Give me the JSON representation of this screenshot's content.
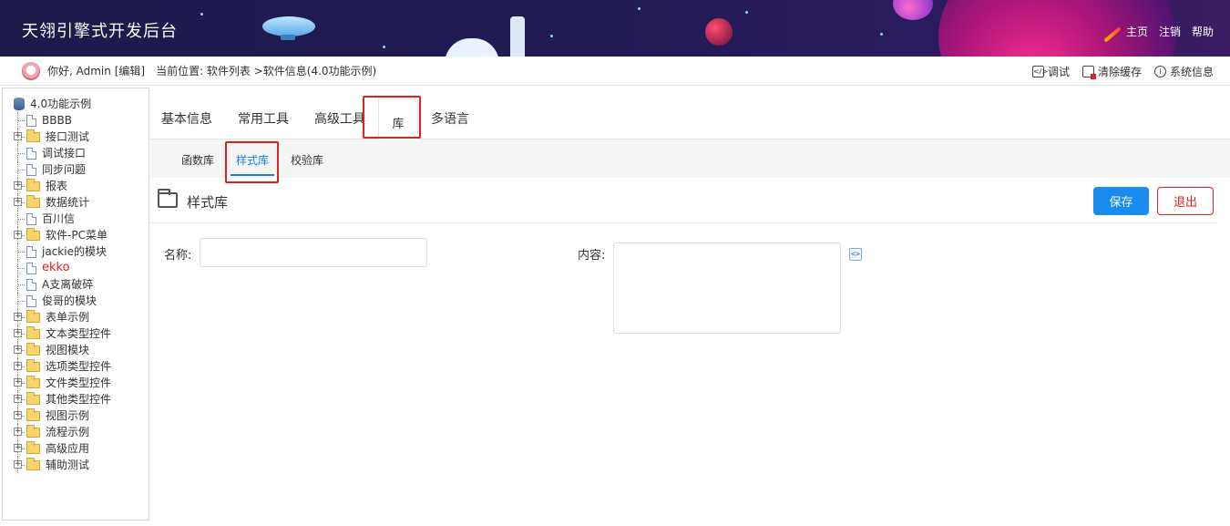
{
  "header": {
    "title": "天翎引擎式开发后台",
    "links": [
      "主页",
      "注销",
      "帮助"
    ]
  },
  "infobar": {
    "greeting": "你好, Admin [编辑]",
    "breadcrumb": "当前位置: 软件列表 >软件信息(4.0功能示例)",
    "debug": "调试",
    "clear_cache": "清除缓存",
    "system_info": "系统信息"
  },
  "tree": {
    "root": "4.0功能示例",
    "items": [
      {
        "label": "BBBB",
        "type": "file"
      },
      {
        "label": "接口测试",
        "type": "folder"
      },
      {
        "label": "调试接口",
        "type": "file"
      },
      {
        "label": "同步问题",
        "type": "file"
      },
      {
        "label": "报表",
        "type": "folder"
      },
      {
        "label": "数据统计",
        "type": "folder"
      },
      {
        "label": "百川信",
        "type": "file"
      },
      {
        "label": "软件-PC菜单",
        "type": "folder"
      },
      {
        "label": "jackie的模块",
        "type": "file"
      },
      {
        "label": "ekko",
        "type": "file",
        "highlight": true
      },
      {
        "label": "A支离破碎",
        "type": "file"
      },
      {
        "label": "俊哥的模块",
        "type": "file"
      },
      {
        "label": "表单示例",
        "type": "folder"
      },
      {
        "label": "文本类型控件",
        "type": "folder"
      },
      {
        "label": "视图模块",
        "type": "folder"
      },
      {
        "label": "选项类型控件",
        "type": "folder"
      },
      {
        "label": "文件类型控件",
        "type": "folder"
      },
      {
        "label": "其他类型控件",
        "type": "folder"
      },
      {
        "label": "视图示例",
        "type": "folder"
      },
      {
        "label": "流程示例",
        "type": "folder"
      },
      {
        "label": "高级应用",
        "type": "folder"
      },
      {
        "label": "辅助测试",
        "type": "folder"
      }
    ]
  },
  "tabs": {
    "basic": "基本信息",
    "tools": "常用工具",
    "advanced": "高级工具",
    "library": "库",
    "i18n": "多语言"
  },
  "subtabs": {
    "functions": "函数库",
    "styles": "样式库",
    "validation": "校验库"
  },
  "section": {
    "title": "样式库",
    "save": "保存",
    "exit": "退出"
  },
  "form": {
    "name_label": "名称:",
    "name_value": "",
    "content_label": "内容:",
    "content_value": ""
  },
  "colors": {
    "accent": "#1a8cf0",
    "danger": "#e0201c",
    "header_bg": "#1d1a4a"
  }
}
